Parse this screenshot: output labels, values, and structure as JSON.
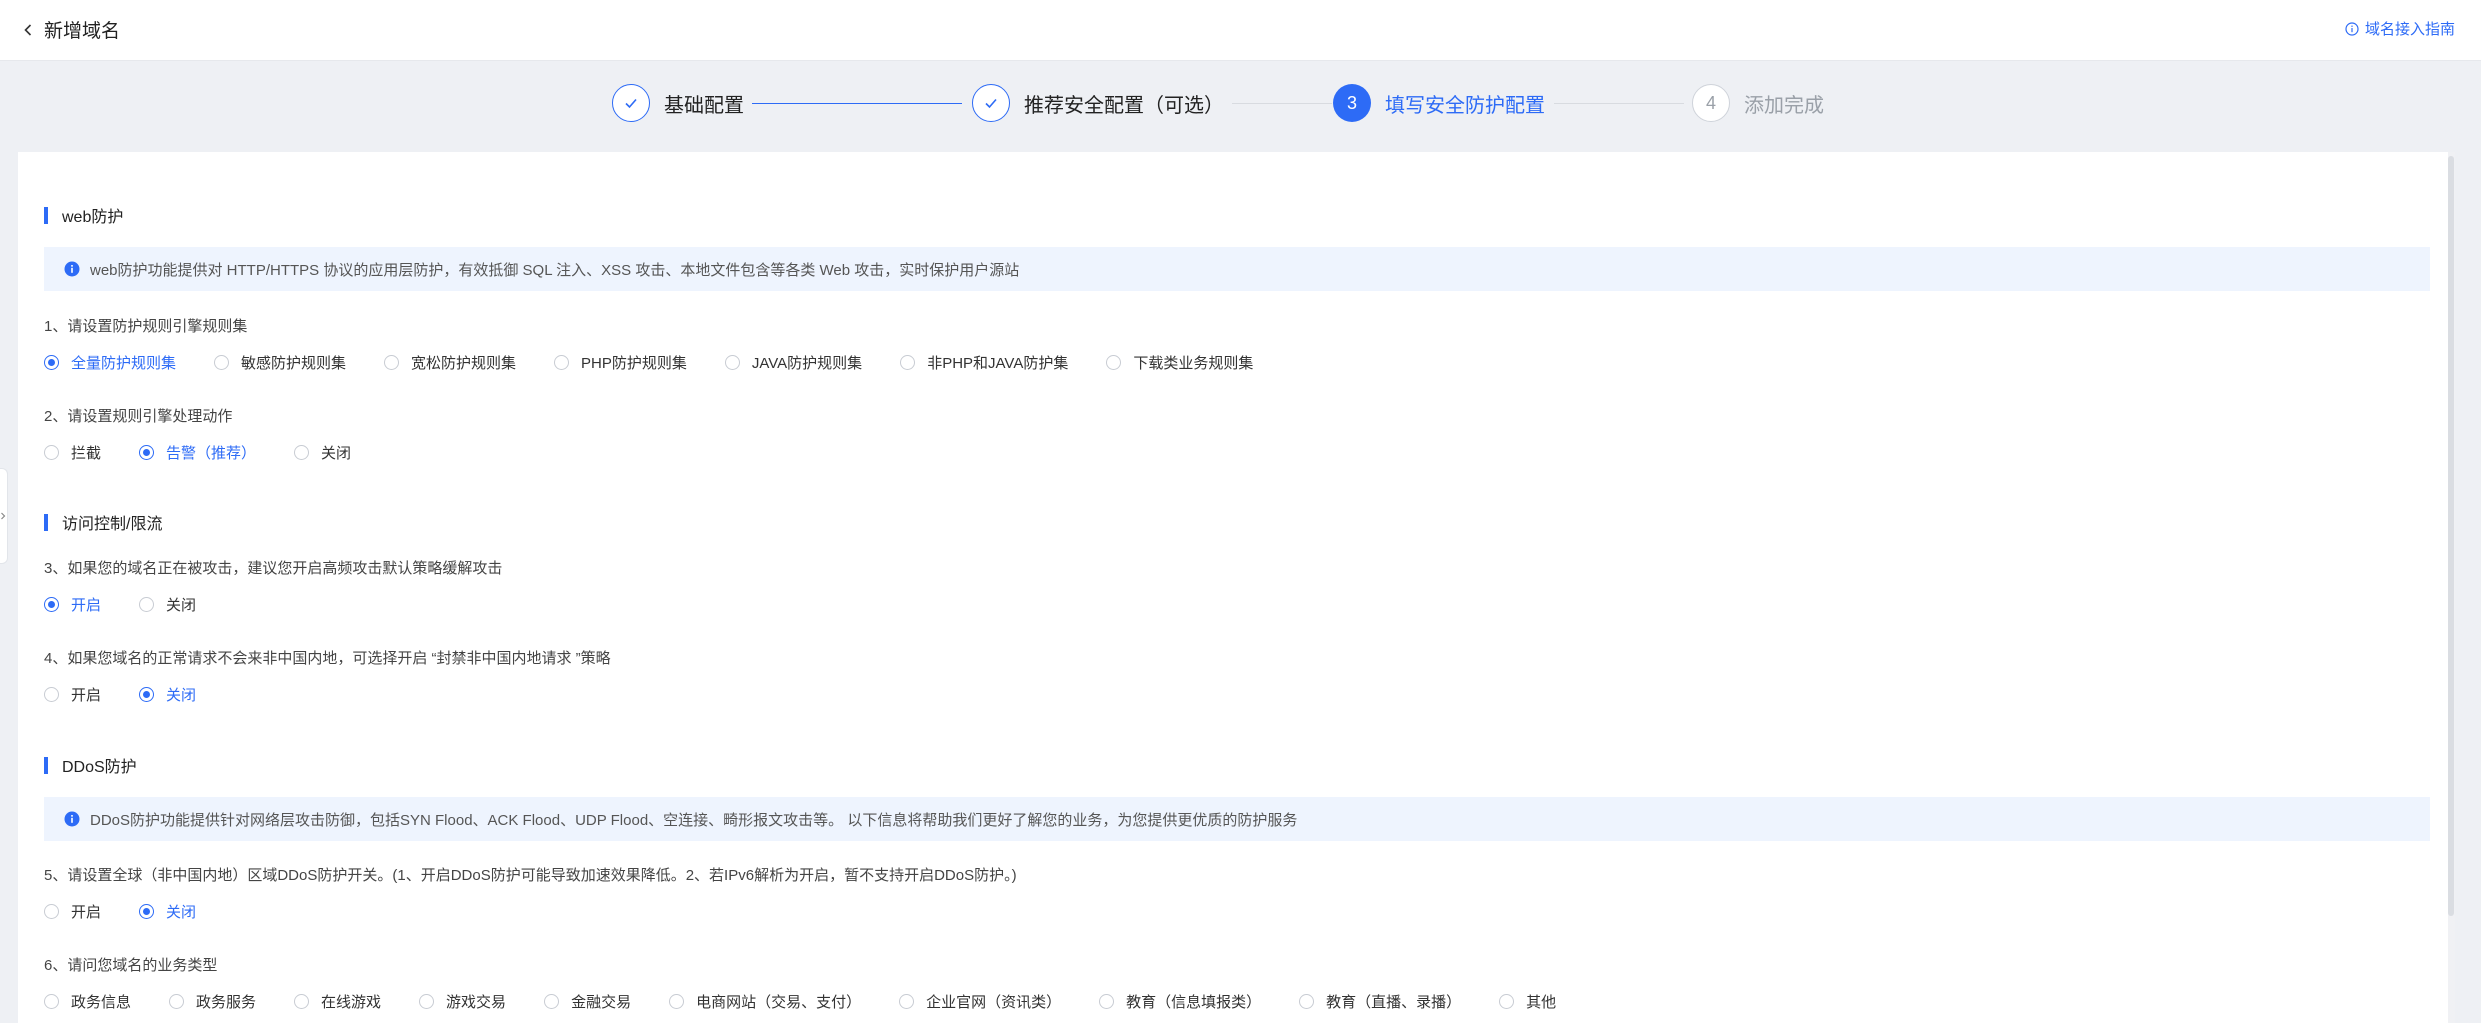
{
  "header": {
    "back_icon": "chevron-left-icon",
    "title": "新增域名",
    "guide_icon": "info-circle-icon",
    "guide_label": "域名接入指南"
  },
  "steps": [
    {
      "label": "基础配置",
      "state": "done"
    },
    {
      "label": "推荐安全配置（可选）",
      "state": "done"
    },
    {
      "number": "3",
      "label": "填写安全防护配置",
      "state": "active"
    },
    {
      "number": "4",
      "label": "添加完成",
      "state": "todo"
    }
  ],
  "sections": {
    "web": {
      "title": "web防护",
      "info": "web防护功能提供对 HTTP/HTTPS 协议的应用层防护，有效抵御 SQL 注入、XSS 攻击、本地文件包含等各类 Web 攻击，实时保护用户源站",
      "q1": {
        "label": "1、请设置防护规则引擎规则集",
        "options": [
          "全量防护规则集",
          "敏感防护规则集",
          "宽松防护规则集",
          "PHP防护规则集",
          "JAVA防护规则集",
          "非PHP和JAVA防护集",
          "下载类业务规则集"
        ],
        "selected": 0
      },
      "q2": {
        "label": "2、请设置规则引擎处理动作",
        "options": [
          "拦截",
          "告警（推荐）",
          "关闭"
        ],
        "selected": 1
      }
    },
    "access": {
      "title": "访问控制/限流",
      "q3": {
        "label": "3、如果您的域名正在被攻击，建议您开启高频攻击默认策略缓解攻击",
        "options": [
          "开启",
          "关闭"
        ],
        "selected": 0
      },
      "q4": {
        "label": "4、如果您域名的正常请求不会来非中国内地，可选择开启 “封禁非中国内地请求 ”策略",
        "options": [
          "开启",
          "关闭"
        ],
        "selected": 1
      }
    },
    "ddos": {
      "title": "DDoS防护",
      "info": "DDoS防护功能提供针对网络层攻击防御，包括SYN Flood、ACK Flood、UDP Flood、空连接、畸形报文攻击等。 以下信息将帮助我们更好了解您的业务，为您提供更优质的防护服务",
      "q5": {
        "label": "5、请设置全球（非中国内地）区域DDoS防护开关。(1、开启DDoS防护可能导致加速效果降低。2、若IPv6解析为开启，暂不支持开启DDoS防护。)",
        "options": [
          "开启",
          "关闭"
        ],
        "selected": 1
      },
      "q6": {
        "label": "6、请问您域名的业务类型",
        "options": [
          "政务信息",
          "政务服务",
          "在线游戏",
          "游戏交易",
          "金融交易",
          "电商网站（交易、支付）",
          "企业官网（资讯类）",
          "教育（信息填报类）",
          "教育（直播、录播）",
          "其他"
        ],
        "selected": -1
      }
    }
  },
  "colors": {
    "accent": "#2d6bf6",
    "info_bg": "#eef4fe",
    "page_bg": "#eef0f4"
  }
}
